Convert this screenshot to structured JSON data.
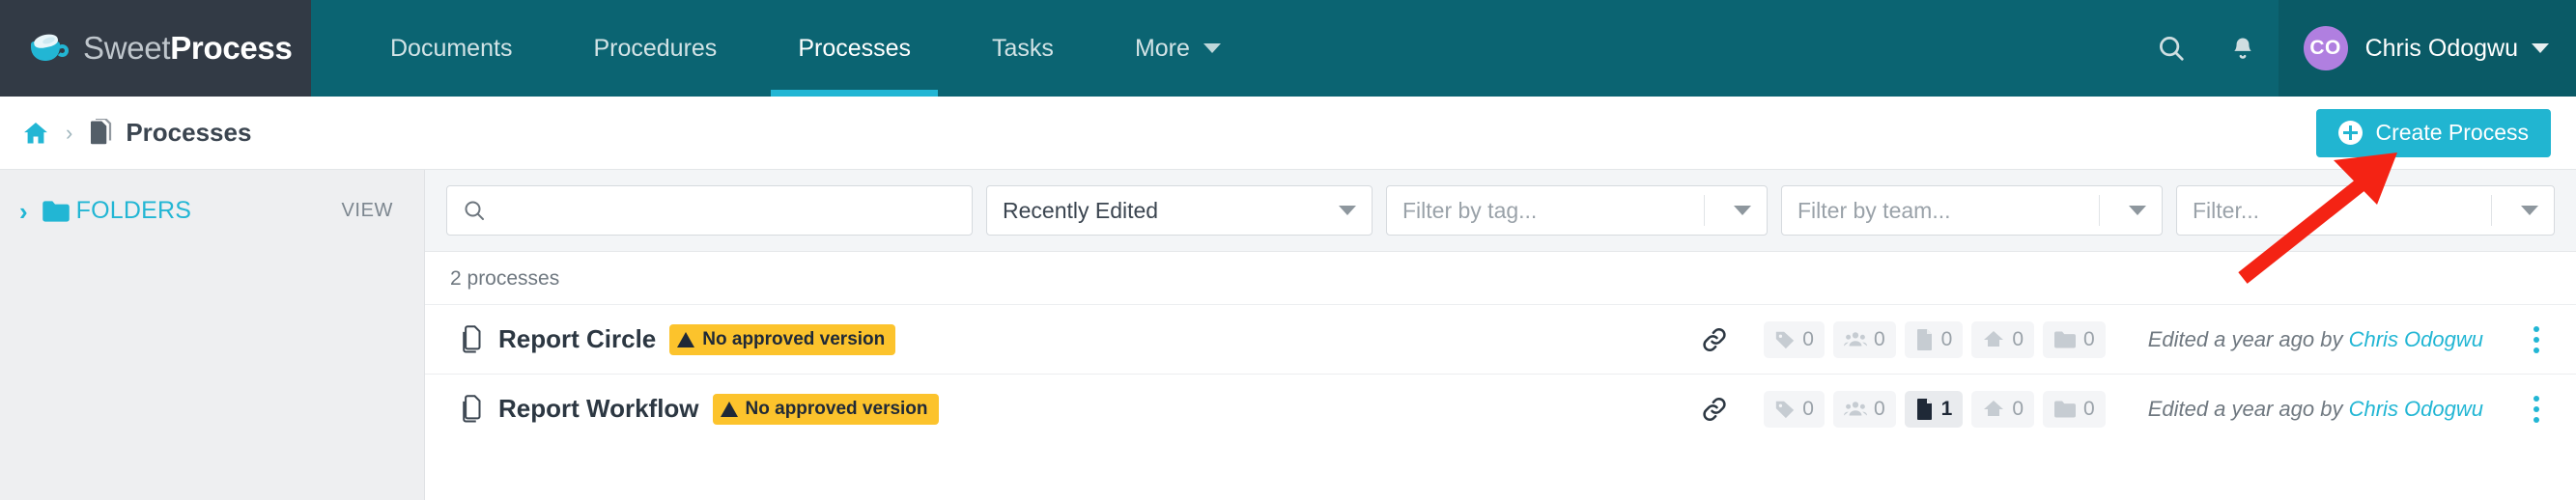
{
  "brand": {
    "name_thin": "Sweet",
    "name_bold": "Process",
    "logo_icon": "coffee-cup-icon"
  },
  "topnav": {
    "tabs": [
      {
        "label": "Documents",
        "active": false
      },
      {
        "label": "Procedures",
        "active": false
      },
      {
        "label": "Processes",
        "active": true
      },
      {
        "label": "Tasks",
        "active": false
      },
      {
        "label": "More",
        "active": false,
        "has_caret": true
      }
    ],
    "search_icon": "search-icon",
    "notifications_icon": "bell-icon",
    "user": {
      "initials": "CO",
      "name": "Chris Odogwu",
      "caret": "chevron-down-icon",
      "avatar_color": "#b07fe0"
    }
  },
  "breadcrumb": {
    "home_icon": "home-icon",
    "separator": "›",
    "doc_icon": "documents-stack-icon",
    "current": "Processes"
  },
  "create_button": {
    "label": "Create Process",
    "icon": "plus-circle-icon",
    "color": "#21b5d1"
  },
  "sidebar": {
    "chevron": "›",
    "folder_icon": "folder-icon",
    "folders_label": "FOLDERS",
    "view_label": "VIEW"
  },
  "filters": {
    "search": {
      "value": "",
      "placeholder": "",
      "icon": "search-icon"
    },
    "sort": {
      "value": "Recently Edited"
    },
    "tag": {
      "value": "Filter by tag..."
    },
    "team": {
      "value": "Filter by team..."
    },
    "misc": {
      "value": "Filter..."
    }
  },
  "list": {
    "count_text": "2 processes",
    "rows": [
      {
        "doc_icon": "document-copy-icon",
        "title": "Report Circle",
        "badge": {
          "text": "No approved version",
          "icon": "warning-triangle-icon",
          "color": "#fcc32c"
        },
        "link_icon": "link-icon",
        "stats": [
          {
            "icon": "tag-icon",
            "value": "0",
            "highlighted": false
          },
          {
            "icon": "teams-icon",
            "value": "0",
            "highlighted": false
          },
          {
            "icon": "file-icon",
            "value": "0",
            "highlighted": false
          },
          {
            "icon": "upload-icon",
            "value": "0",
            "highlighted": false
          },
          {
            "icon": "folder-icon",
            "value": "0",
            "highlighted": false
          }
        ],
        "edited_prefix": "Edited a year ago by ",
        "edited_author": "Chris Odogwu",
        "menu_icon": "kebab-menu-icon"
      },
      {
        "doc_icon": "document-copy-icon",
        "title": "Report Workflow",
        "badge": {
          "text": "No approved version",
          "icon": "warning-triangle-icon",
          "color": "#fcc32c"
        },
        "link_icon": "link-icon",
        "stats": [
          {
            "icon": "tag-icon",
            "value": "0",
            "highlighted": false
          },
          {
            "icon": "teams-icon",
            "value": "0",
            "highlighted": false
          },
          {
            "icon": "file-icon",
            "value": "1",
            "highlighted": true
          },
          {
            "icon": "upload-icon",
            "value": "0",
            "highlighted": false
          },
          {
            "icon": "folder-icon",
            "value": "0",
            "highlighted": false
          }
        ],
        "edited_prefix": "Edited a year ago by ",
        "edited_author": "Chris Odogwu",
        "menu_icon": "kebab-menu-icon"
      }
    ]
  },
  "annotation": {
    "arrow_color": "#f42314",
    "points_to": "create-process-button"
  }
}
